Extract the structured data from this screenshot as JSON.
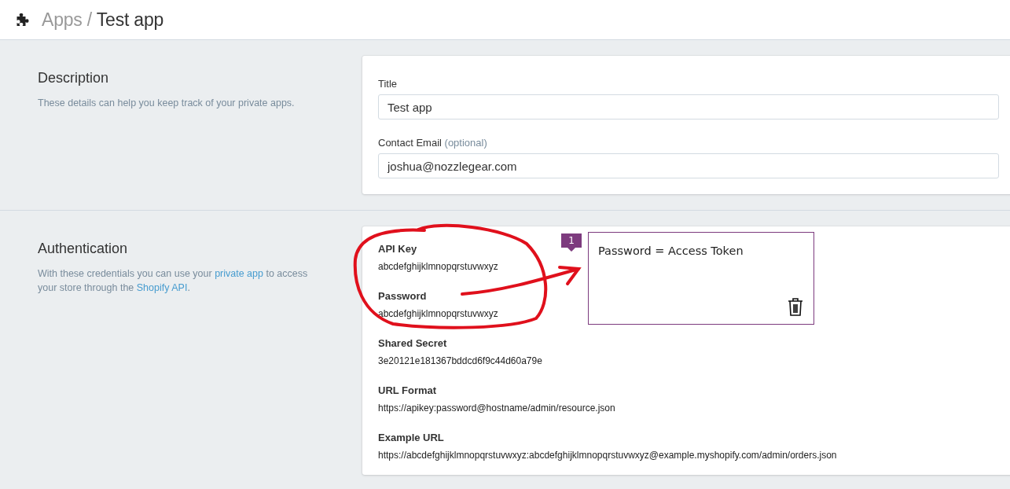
{
  "header": {
    "parent": "Apps",
    "separator": "/",
    "title": "Test app"
  },
  "sections": [
    {
      "heading": "Description",
      "description": [
        {
          "kind": "text",
          "text": "These details can help you keep track of your private apps."
        }
      ],
      "fields": [
        {
          "label": "Title",
          "value": "Test app"
        },
        {
          "label": "Contact Email",
          "hint": "(optional)",
          "value": "joshua@nozzlegear.com"
        }
      ]
    },
    {
      "heading": "Authentication",
      "description": [
        {
          "kind": "text",
          "text": "With these credentials you can use your "
        },
        {
          "kind": "link",
          "text": "private app"
        },
        {
          "kind": "text",
          "text": " to access your store through the "
        },
        {
          "kind": "link",
          "text": "Shopify API"
        },
        {
          "kind": "text",
          "text": "."
        }
      ],
      "credentials": [
        {
          "label": "API Key",
          "value": "abcdefghijklmnopqrstuvwxyz"
        },
        {
          "label": "Password",
          "value": "abcdefghijklmnopqrstuvwxyz"
        },
        {
          "label": "Shared Secret",
          "value": "3e20121e181367bddcd6f9c44d60a79e"
        },
        {
          "label": "URL Format",
          "value": "https://apikey:password@hostname/admin/resource.json"
        },
        {
          "label": "Example URL",
          "value": "https://abcdefghijklmnopqrstuvwxyz:abcdefghijklmnopqrstuvwxyz@example.myshopify.com/admin/orders.json"
        }
      ]
    }
  ],
  "annotation": {
    "number": "1",
    "comment": "Password = Access Token"
  }
}
